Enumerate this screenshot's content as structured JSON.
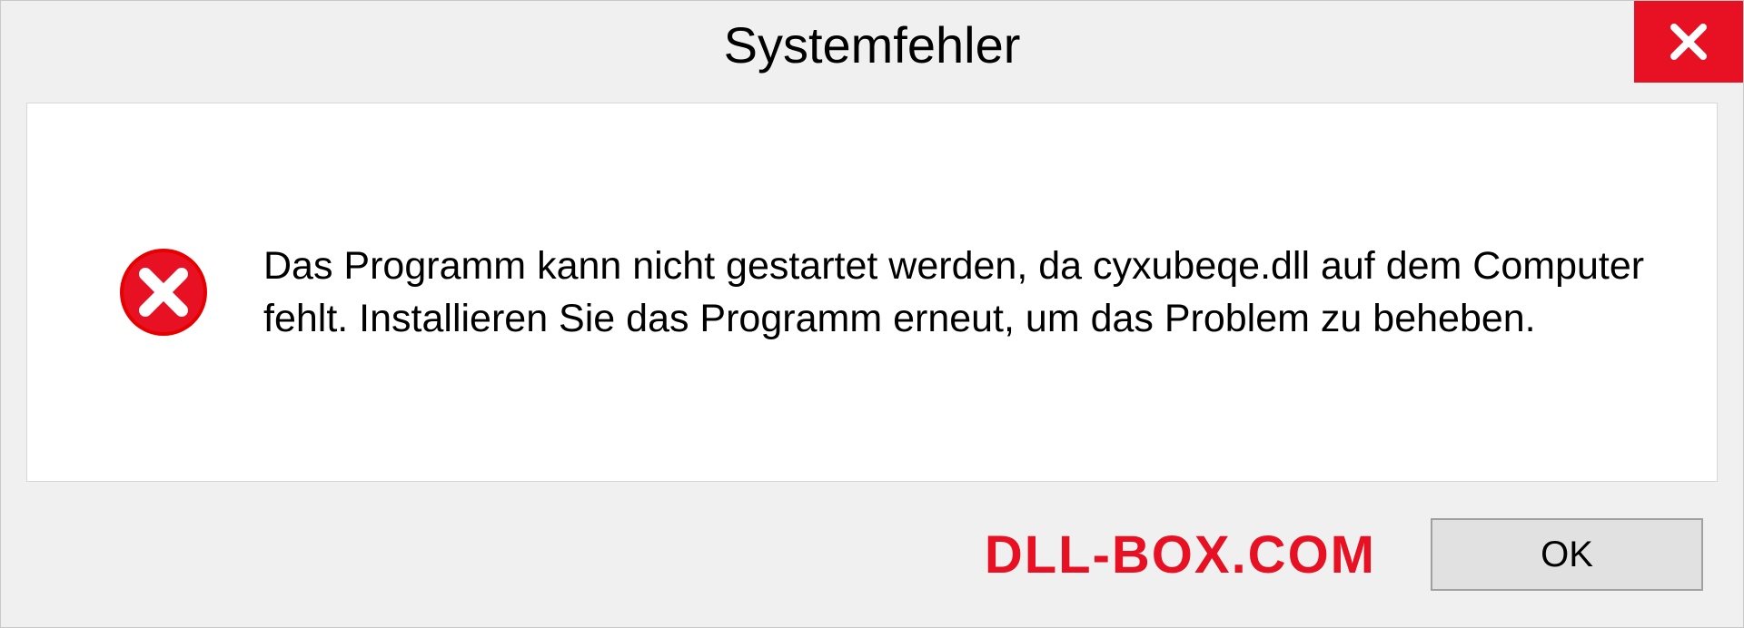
{
  "dialog": {
    "title": "Systemfehler",
    "message": "Das Programm kann nicht gestartet werden, da cyxubeqe.dll auf dem Computer fehlt. Installieren Sie das Programm erneut, um das Problem zu beheben.",
    "ok_label": "OK"
  },
  "watermark": "DLL-BOX.COM"
}
